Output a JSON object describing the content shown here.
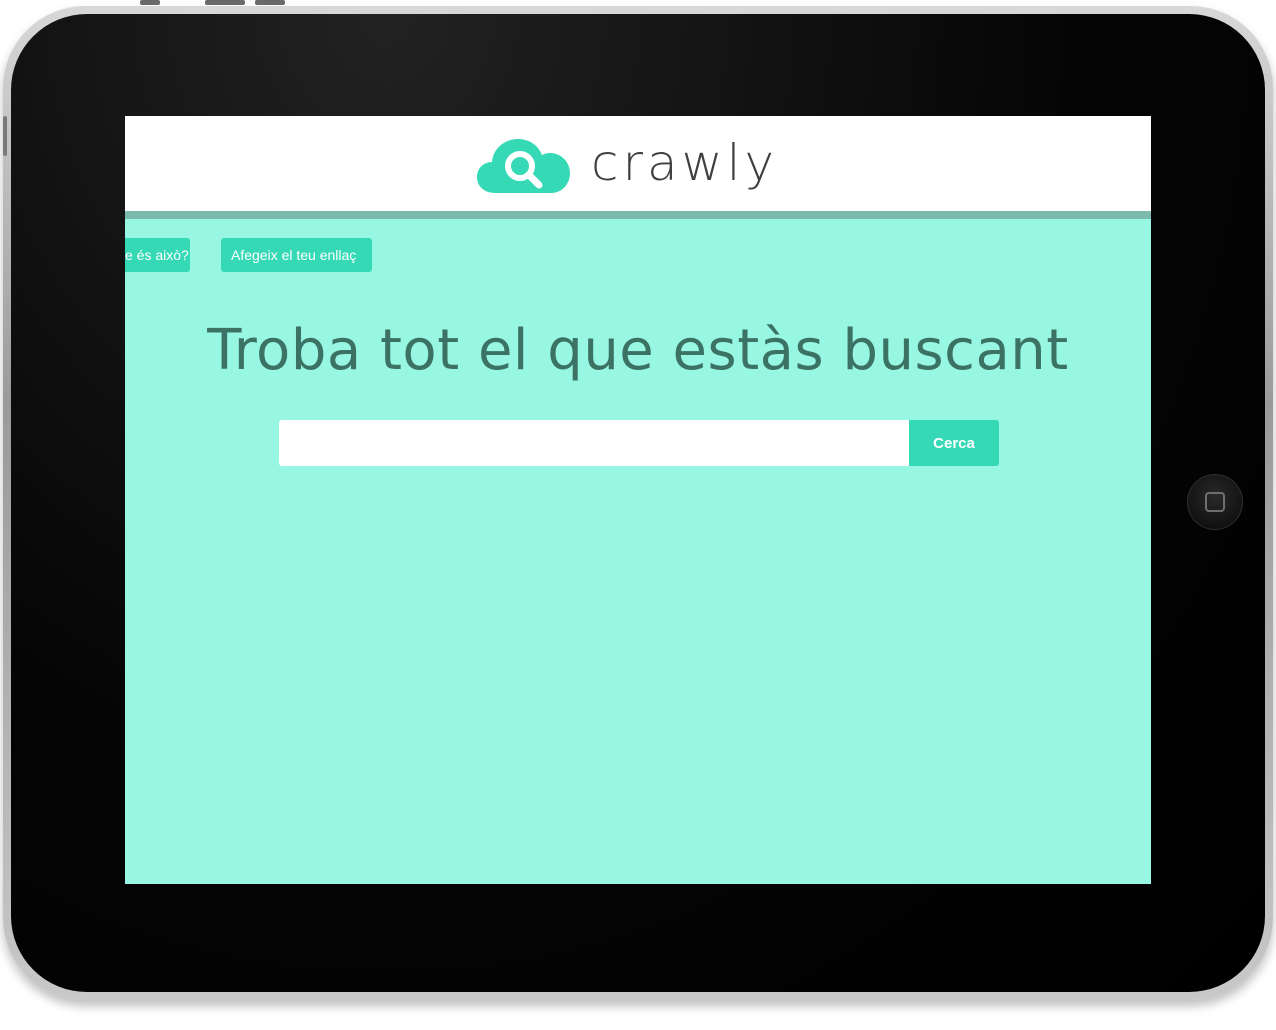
{
  "app": {
    "name": "crawly",
    "brand_color": "#36d9b5",
    "background_color": "#98f7e3",
    "header_rule_color": "#7cb9ad",
    "headline_color": "#3c7264"
  },
  "nav": {
    "items": [
      {
        "label": "Què és això?",
        "visible_text": "e és això?"
      },
      {
        "label": "Afegeix el teu enllaç"
      }
    ]
  },
  "hero": {
    "headline": "Troba tot el que estàs buscant"
  },
  "search": {
    "value": "",
    "placeholder": "",
    "button_label": "Cerca"
  },
  "device": {
    "type": "tablet",
    "home_button_icon": "home-square-icon"
  }
}
